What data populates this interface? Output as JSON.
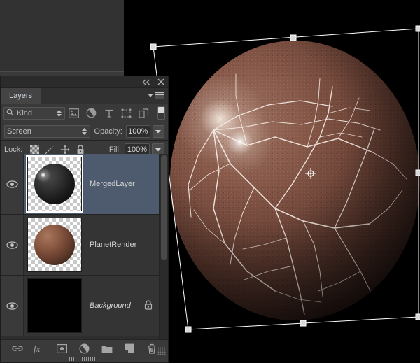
{
  "app": {
    "workspace_bg": "#323232",
    "canvas_bg": "#000000"
  },
  "panel": {
    "title": "Layers",
    "tab_label": "Layers",
    "collapse_icon": "collapse-double-arrow-icon",
    "close_icon": "close-icon",
    "menu_icon": "panel-menu-icon",
    "filter": {
      "kind_label": "Kind",
      "search_icon": "search-icon",
      "stepper_icon": "stepper-arrows-icon",
      "icons": [
        {
          "name": "filter-pixel-layers-icon",
          "glyph": "image"
        },
        {
          "name": "filter-adjustment-layers-icon",
          "glyph": "half-circle"
        },
        {
          "name": "filter-type-layers-icon",
          "glyph": "T"
        },
        {
          "name": "filter-shape-layers-icon",
          "glyph": "shape"
        },
        {
          "name": "filter-smart-object-icon",
          "glyph": "smart-object"
        }
      ],
      "toggle_name": "filter-enable-toggle"
    },
    "blend": {
      "mode_label": "Screen",
      "opacity_label": "Opacity:",
      "opacity_value": "100%"
    },
    "lock": {
      "label": "Lock:",
      "icons": [
        {
          "name": "lock-transparent-pixels-icon"
        },
        {
          "name": "lock-image-pixels-icon"
        },
        {
          "name": "lock-position-icon"
        },
        {
          "name": "lock-all-icon"
        }
      ],
      "fill_label": "Fill:",
      "fill_value": "100%"
    },
    "layers": [
      {
        "name": "MergedLayer",
        "selected": true,
        "visible": true,
        "locked": false,
        "italic": false,
        "thumb": "dark-sphere"
      },
      {
        "name": "PlanetRender",
        "selected": false,
        "visible": true,
        "locked": false,
        "italic": false,
        "thumb": "brown-sphere"
      },
      {
        "name": "Background",
        "selected": false,
        "visible": true,
        "locked": true,
        "italic": true,
        "thumb": "solid-black"
      }
    ],
    "bottom_icons": [
      {
        "name": "link-layers-icon"
      },
      {
        "name": "layer-style-fx-icon"
      },
      {
        "name": "add-layer-mask-icon"
      },
      {
        "name": "new-adjustment-layer-icon"
      },
      {
        "name": "new-group-icon"
      },
      {
        "name": "new-layer-icon"
      },
      {
        "name": "delete-layer-icon"
      }
    ],
    "selected_accent": "#4e5a6e"
  },
  "canvas": {
    "artwork_name": "planet-render",
    "transform_active": true,
    "reference_point_icon": "transform-reference-point-icon",
    "handle_count": 8
  }
}
